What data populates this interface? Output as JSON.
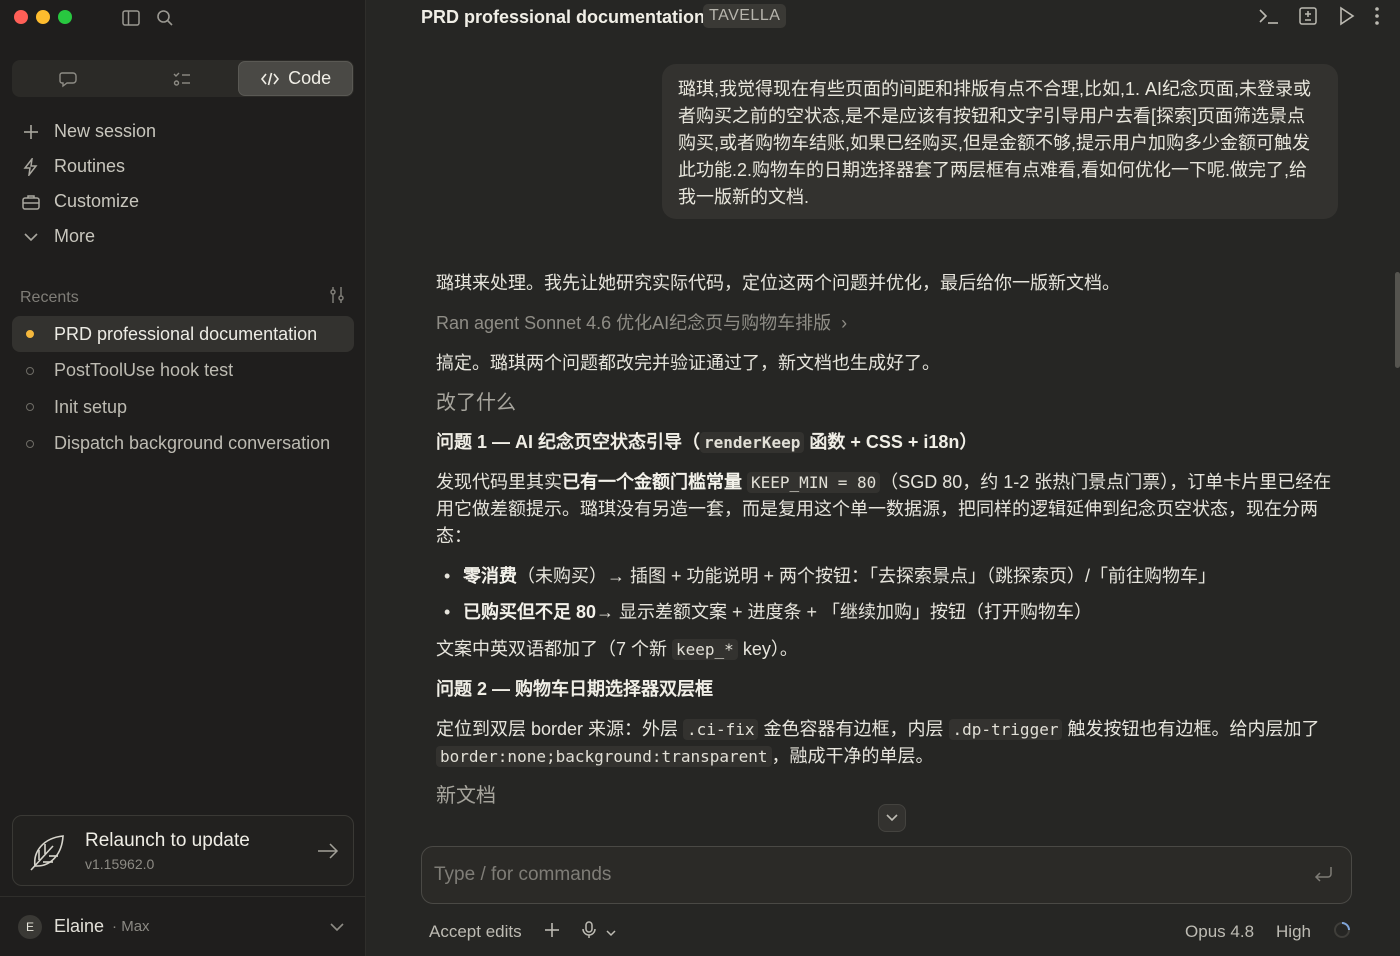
{
  "sidebar": {
    "modes": [
      {
        "label": "",
        "icon": "chat-icon"
      },
      {
        "label": "",
        "icon": "tasks-icon"
      },
      {
        "label": "Code",
        "icon": "code-icon"
      }
    ],
    "nav": [
      {
        "label": "New session",
        "icon": "plus-icon"
      },
      {
        "label": "Routines",
        "icon": "bolt-icon"
      },
      {
        "label": "Customize",
        "icon": "briefcase-icon"
      },
      {
        "label": "More",
        "icon": "chevron-down-icon"
      }
    ],
    "recents_label": "Recents",
    "recents": [
      {
        "label": "PRD professional documentation",
        "active": true
      },
      {
        "label": "PostToolUse hook test",
        "active": false
      },
      {
        "label": "Init setup",
        "active": false
      },
      {
        "label": "Dispatch background conversation",
        "active": false
      }
    ],
    "update": {
      "title": "Relaunch to update",
      "version": "v1.15962.0"
    },
    "user": {
      "initial": "E",
      "name": "Elaine",
      "plan": "· Max"
    }
  },
  "header": {
    "title": "PRD professional documentation",
    "project": "TAVELLA"
  },
  "user_message": "璐琪,我觉得现在有些页面的间距和排版有点不合理,比如,1. AI纪念页面,未登录或者购买之前的空状态,是不是应该有按钮和文字引导用户去看[探索]页面筛选景点购买,或者购物车结账,如果已经购买,但是金额不够,提示用户加购多少金额可触发此功能.2.购物车的日期选择器套了两层框有点难看,看如何优化一下呢.做完了,给我一版新的文档.",
  "assistant": {
    "intro": "璐琪来处理。我先让她研究实际代码，定位这两个问题并优化，最后给你一版新文档。",
    "agent_link": "Ran agent Sonnet 4.6 优化AI纪念页与购物车排版",
    "done": "搞定。璐琪两个问题都改完并验证通过了，新文档也生成好了。",
    "section_changes": "改了什么",
    "issue1": {
      "title_pre": "问题 1 — AI 纪念页空状态引导（",
      "title_code": "renderKeep",
      "title_post": " 函数 + CSS + i18n）",
      "para_pre": "发现代码里其实",
      "para_strong": "已有一个金额门槛常量",
      "para_code": "KEEP_MIN = 80",
      "para_post": "（SGD 80，约 1-2 张热门景点门票），订单卡片里已经在用它做差额提示。璐琪没有另造一套，而是复用这个单一数据源，把同样的逻辑延伸到纪念页空状态，现在分两态：",
      "bullet1_strong": "零消费",
      "bullet1_rest": "（未购买）→ 插图 + 功能说明 + 两个按钮：「去探索景点」（跳探索页）/「前往购物车」",
      "bullet2_strong": "已购买但不足 80",
      "bullet2_rest": "→ 显示差额文案 + 进度条 + 「继续加购」按钮（打开购物车）",
      "i18n_pre": "文案中英双语都加了（7 个新 ",
      "i18n_code": "keep_*",
      "i18n_post": " key）。"
    },
    "issue2": {
      "title": "问题 2 — 购物车日期选择器双层框",
      "para_pre": "定位到双层 border 来源：外层 ",
      "para_code1": ".ci-fix",
      "para_mid1": " 金色容器有边框，内层 ",
      "para_code2": ".dp-trigger",
      "para_mid2": " 触发按钮也有边框。给内层加了 ",
      "para_code3": "border:none;background:transparent",
      "para_post": "，融成干净的单层。"
    },
    "section_newdoc": "新文档"
  },
  "composer": {
    "placeholder": "Type / for commands"
  },
  "footer": {
    "accept_edits": "Accept edits",
    "model": "Opus 4.8",
    "effort": "High"
  },
  "colors": {
    "accent_dot": "#f5b83d",
    "background": "#262624",
    "sidebar": "#1f1e1d"
  }
}
